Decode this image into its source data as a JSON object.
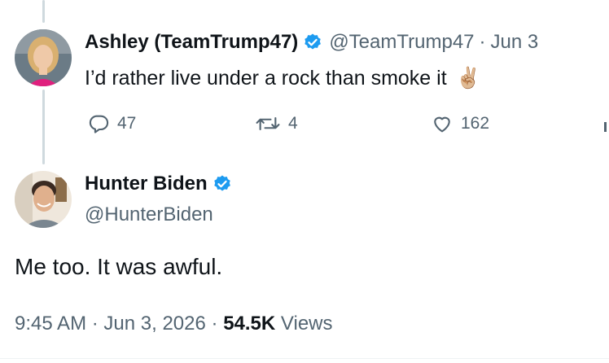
{
  "reply_to": {
    "display_name": "Ashley (TeamTrump47)",
    "handle": "@TeamTrump47",
    "separator": "·",
    "date": "Jun 3",
    "text": "I’d rather live under a rock than smoke it",
    "emoji": "✌🏼",
    "replies": "47",
    "reposts": "4",
    "likes": "162",
    "avatar_icon": "woman-portrait-avatar",
    "verified_color": "#1d9bf0"
  },
  "main_tweet": {
    "display_name": "Hunter Biden",
    "handle": "@HunterBiden",
    "text": "Me too. It was awful.",
    "time": "9:45 AM",
    "separator": "·",
    "date": "Jun 3, 2026",
    "separator2": "·",
    "views_count": "54.5K",
    "views_label": "Views",
    "avatar_icon": "man-portrait-avatar"
  },
  "colors": {
    "text": "#0f1419",
    "muted": "#536471",
    "thread_line": "#cfd9de",
    "verified": "#1d9bf0"
  }
}
